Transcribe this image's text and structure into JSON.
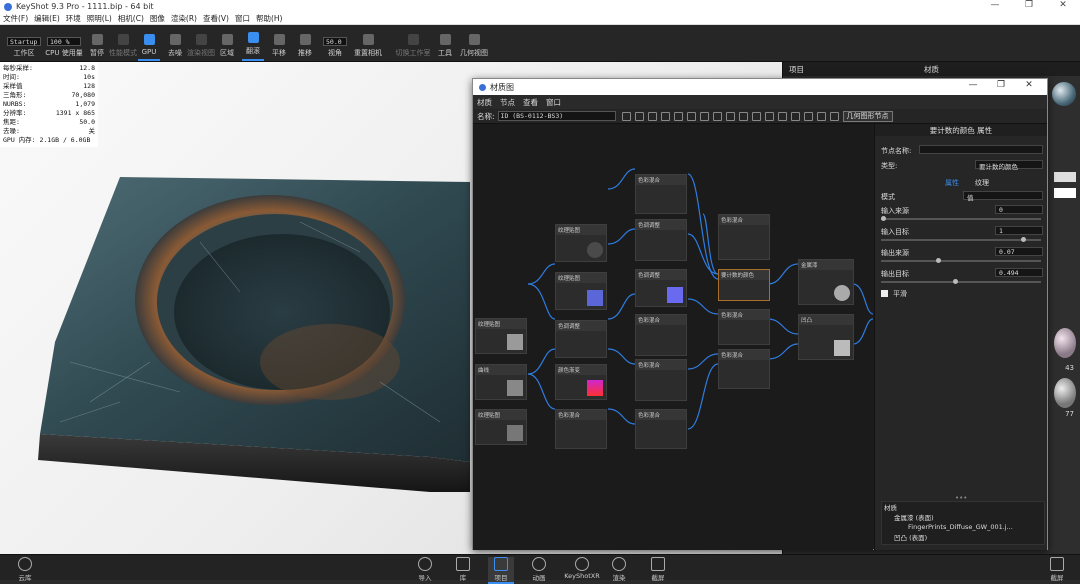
{
  "app": {
    "title": "KeyShot 9.3 Pro  -  1111.bip  -  64 bit",
    "window_controls": [
      "—",
      "❐",
      "✕"
    ]
  },
  "menubar": [
    "文件(F)",
    "编辑(E)",
    "环境",
    "照明(L)",
    "相机(C)",
    "图像",
    "渲染(R)",
    "查看(V)",
    "窗口",
    "帮助(H)"
  ],
  "toolbar": {
    "workspace_value": "Startup",
    "zoom_value": "100 %",
    "fov_value": "50.0",
    "items": [
      {
        "label": "工作区",
        "icon": "workspace-icon"
      },
      {
        "label": "CPU 使用量",
        "icon": "cpu-icon"
      },
      {
        "label": "暂停",
        "icon": "pause-icon"
      },
      {
        "label": "性能模式",
        "icon": "performance-icon"
      },
      {
        "label": "GPU",
        "icon": "gpu-icon"
      },
      {
        "label": "去噪",
        "icon": "denoise-icon"
      },
      {
        "label": "渲染视图",
        "icon": "render-view-icon"
      },
      {
        "label": "区域",
        "icon": "region-icon"
      },
      {
        "label": "翻滚",
        "icon": "tumble-icon"
      },
      {
        "label": "平移",
        "icon": "pan-icon"
      },
      {
        "label": "推移",
        "icon": "dolly-icon"
      },
      {
        "label": "视角",
        "icon": "fov-icon"
      },
      {
        "label": "重置相机",
        "icon": "reset-camera-icon"
      },
      {
        "label": "切换工作室",
        "icon": "studio-icon"
      },
      {
        "label": "工具",
        "icon": "tools-icon"
      },
      {
        "label": "几何视图",
        "icon": "geometry-view-icon"
      }
    ]
  },
  "stats": [
    {
      "k": "每秒采样:",
      "v": "12.8"
    },
    {
      "k": "时间:",
      "v": "10s"
    },
    {
      "k": "采样值",
      "v": "128"
    },
    {
      "k": "三角形:",
      "v": "70,080"
    },
    {
      "k": "NURBS:",
      "v": "1,079"
    },
    {
      "k": "分辨率:",
      "v": "1391 x 865"
    },
    {
      "k": "焦距:",
      "v": "50.0"
    },
    {
      "k": "去噪:",
      "v": "关"
    }
  ],
  "gpu_memory": "GPU 内存: 2.1GB / 6.0GB",
  "right_panel": {
    "tab1": "项目",
    "tab2": "材质",
    "thumb_labels": [
      "43",
      "77"
    ]
  },
  "bottombar": [
    {
      "label": "云库",
      "icon": "cloud-library-icon"
    },
    {
      "label": "导入",
      "icon": "import-icon"
    },
    {
      "label": "库",
      "icon": "library-icon"
    },
    {
      "label": "项目",
      "icon": "project-icon"
    },
    {
      "label": "动画",
      "icon": "animation-icon"
    },
    {
      "label": "KeyShotXR",
      "icon": "keyshotxr-icon"
    },
    {
      "label": "渲染",
      "icon": "render-icon"
    },
    {
      "label": "截屏",
      "icon": "screenshot-icon"
    }
  ],
  "bottom_right_label": "截屏",
  "material_window": {
    "title": "材质图",
    "menu": [
      "材质",
      "节点",
      "查看",
      "窗口"
    ],
    "name_label": "名称:",
    "name_value": "ID (BS-0112-BS3)",
    "geom_button": "几何图形节点",
    "nodes": [
      {
        "title": "纹理贴图",
        "thumb": "#4a4a4a"
      },
      {
        "title": "纹理贴图",
        "thumb": "#5b66d9"
      },
      {
        "title": "纹理贴图",
        "thumb": "#9a9a9a"
      },
      {
        "title": "色调调整",
        "thumb": ""
      },
      {
        "title": "色调调整",
        "thumb": "#6a6af0"
      },
      {
        "title": "色调调整",
        "thumb": ""
      },
      {
        "title": "颜色渐变",
        "thumb": "#d025d0"
      },
      {
        "title": "色彩混合",
        "thumb": ""
      },
      {
        "title": "色彩混合",
        "thumb": ""
      },
      {
        "title": "曲线",
        "thumb": "#888"
      },
      {
        "title": "纹理贴图",
        "thumb": "#777"
      },
      {
        "title": "色彩混合",
        "thumb": ""
      },
      {
        "title": "色彩混合",
        "thumb": ""
      },
      {
        "title": "色彩混合",
        "thumb": ""
      },
      {
        "title": "色彩混合",
        "thumb": ""
      },
      {
        "title": "要计数的颜色",
        "thumb": "#3a3a3a"
      },
      {
        "title": "色彩混合",
        "thumb": ""
      },
      {
        "title": "色彩混合",
        "thumb": ""
      },
      {
        "title": "金属漆",
        "thumb": "#aaa"
      },
      {
        "title": "凹凸",
        "thumb": "#bbb"
      }
    ],
    "properties": {
      "header": "要计数的颜色 属性",
      "node_name_label": "节点名称:",
      "node_name_value": "",
      "type_label": "类型:",
      "type_value": "要计数的颜色",
      "tab_props": "属性",
      "tab_texture": "纹理",
      "mode_label": "模式",
      "mode_value": "值",
      "fields": [
        {
          "label": "输入来源",
          "value": "0"
        },
        {
          "label": "输入目标",
          "value": "1"
        },
        {
          "label": "输出来源",
          "value": "0.07"
        },
        {
          "label": "输出目标",
          "value": "0.494"
        }
      ],
      "clamp_label": "平滑"
    },
    "tree": [
      {
        "indent": 0,
        "label": "材质"
      },
      {
        "indent": 1,
        "label": "金属漆 (表面)"
      },
      {
        "indent": 2,
        "label": "FingerPrints_Diffuse_GW_001.j..."
      },
      {
        "indent": 1,
        "label": "凹凸 (表面)"
      }
    ]
  }
}
